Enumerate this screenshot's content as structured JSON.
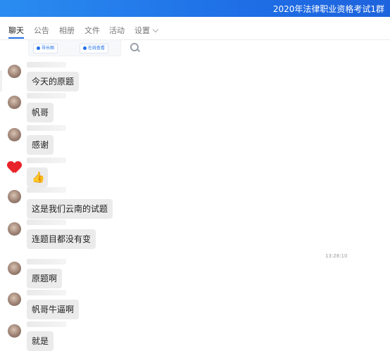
{
  "window": {
    "title": "2020年法律职业资格考试1群"
  },
  "tabs": [
    {
      "label": "聊天",
      "active": true
    },
    {
      "label": "公告"
    },
    {
      "label": "相册"
    },
    {
      "label": "文件"
    },
    {
      "label": "活动"
    },
    {
      "label": "设置"
    }
  ],
  "attachment": {
    "btn1": "导长图",
    "btn2": "在线查看"
  },
  "messages": [
    {
      "text": "今天的原题",
      "avatar": "avatar-icon"
    },
    {
      "text": "帆哥",
      "avatar": "avatar-icon"
    },
    {
      "text": "感谢",
      "avatar": "avatar-icon"
    },
    {
      "text": "👍",
      "avatar": "heart-avatar-icon"
    },
    {
      "text": "这是我们云南的试题",
      "avatar": "avatar-icon"
    },
    {
      "text": "连题目都没有变",
      "avatar": "avatar-icon"
    },
    {
      "text": "原题啊",
      "avatar": "avatar-icon"
    },
    {
      "text": "帆哥牛逼啊",
      "avatar": "avatar-icon"
    },
    {
      "text": "就是",
      "avatar": "avatar-icon"
    }
  ],
  "timestamp": "13:28:10",
  "colors": {
    "accent": "#1f6fe6",
    "bubble": "#ebebeb"
  }
}
